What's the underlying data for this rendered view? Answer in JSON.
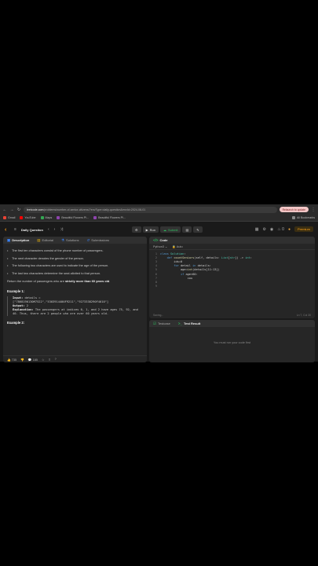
{
  "browser": {
    "back": "←",
    "forward": "→",
    "reload": "↻",
    "url_host": "leetcode.com",
    "url_path": "/problems/number-of-senior-citizens/?envType=daily-question&envId=2024-08-01",
    "update_label": "Relaunch to update"
  },
  "bookmarks": {
    "items": [
      {
        "label": "Gmail",
        "color": "#ea4335"
      },
      {
        "label": "YouTube",
        "color": "#ff0000"
      },
      {
        "label": "Maps",
        "color": "#34a853"
      },
      {
        "label": "Beautiful Flowers Pi...",
        "color": "#8e44ad"
      },
      {
        "label": "Beautiful Flowers Pi...",
        "color": "#8e44ad"
      }
    ],
    "all_label": "All Bookmarks"
  },
  "topbar": {
    "title": "Daily Question",
    "run_label": "Run",
    "submit_label": "Submit",
    "premium_label": "Premium",
    "counter": "0"
  },
  "description": {
    "tabs": [
      "Description",
      "Editorial",
      "Solutions",
      "Submissions"
    ],
    "bullets": [
      "The first ten characters consist of the phone number of passengers.",
      "The next character denotes the gender of the person.",
      "The following two characters are used to indicate the age of the person.",
      "The last two characters determine the seat allotted to that person."
    ],
    "return_prefix": "Return the number of passengers who are ",
    "return_bold": "strictly more than 60 years old",
    "return_suffix": ".",
    "example1_title": "Example 1:",
    "ex_input_label": "Input:",
    "ex_input_value": " details =",
    "ex_input_array": "[\"7868190130M7522\",\"5303914400F9211\",\"9273338290F4010\"]",
    "ex_output_label": "Output:",
    "ex_output_value": " 2",
    "ex_expl_label": "Explanation:",
    "ex_expl_value": " The passengers at indices 0, 1, and 2 have ages 75, 92, and 40. Thus, there are 2 people who are over 60 years old.",
    "example2_title": "Example 2:",
    "likes": "735",
    "dislikes": "185"
  },
  "code": {
    "tab_label": "Code",
    "language": "Python3",
    "auto_label": "Auto",
    "lines": [
      "1",
      "2",
      "3",
      "4",
      "5",
      "6",
      "7",
      "8",
      "9"
    ],
    "status_left": "Saving...",
    "status_right": "Ln 7, Col 30"
  },
  "result": {
    "testcase_tab": "Testcase",
    "result_tab": "Test Result",
    "message": "You must run your code first"
  }
}
